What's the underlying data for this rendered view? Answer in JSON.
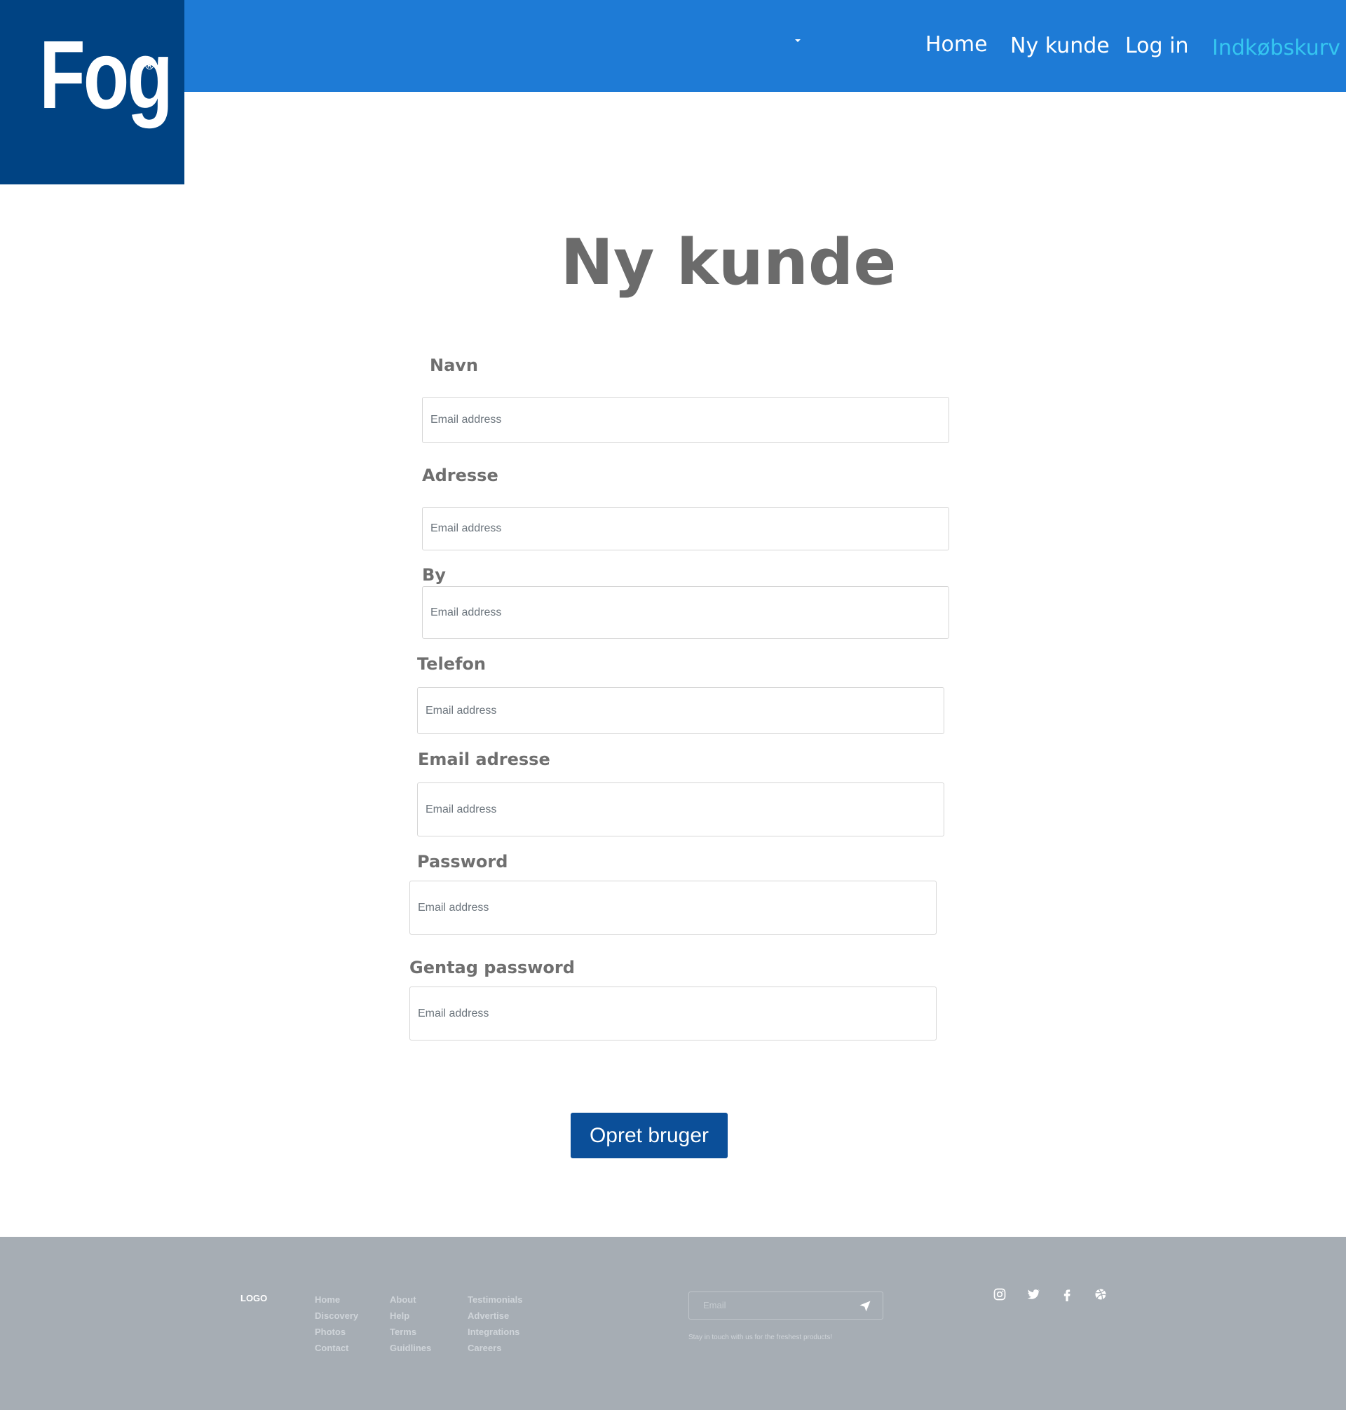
{
  "header": {
    "logo_text": "Fog",
    "logo_mark": "®",
    "nav": [
      {
        "label": "Home"
      },
      {
        "label": "Ny kunde"
      },
      {
        "label": "Log in"
      },
      {
        "label": "Indkøbskurv",
        "color": "#35c6f0"
      }
    ],
    "dropdown_icon": "caret-down-icon",
    "brand_color": "#1e7bd6",
    "logo_bg": "#004383"
  },
  "form": {
    "title": "Ny kunde",
    "fields": [
      {
        "label": "Navn",
        "placeholder": "Email address"
      },
      {
        "label": "Adresse",
        "placeholder": "Email address"
      },
      {
        "label": "By",
        "placeholder": "Email address"
      },
      {
        "label": "Telefon",
        "placeholder": "Email address"
      },
      {
        "label": "Email adresse",
        "placeholder": "Email address"
      },
      {
        "label": "Password",
        "placeholder": "Email address"
      },
      {
        "label": "Gentag password",
        "placeholder": "Email address"
      }
    ],
    "submit_label": "Opret bruger",
    "submit_color": "#0b4f99"
  },
  "footer": {
    "logo": "LOGO",
    "columns": [
      [
        "Home",
        "Discovery",
        "Photos",
        "Contact"
      ],
      [
        "About",
        "Help",
        "Terms",
        "Guidlines"
      ],
      [
        "Testimonials",
        "Advertise",
        "Integrations",
        "Careers"
      ]
    ],
    "email_placeholder": "Email",
    "tagline": "Stay in touch with us for the freshest products!",
    "send_icon": "send-icon",
    "social_icons": [
      "instagram-icon",
      "twitter-icon",
      "facebook-icon",
      "dribbble-icon"
    ],
    "bg_color": "#a6adb4"
  }
}
